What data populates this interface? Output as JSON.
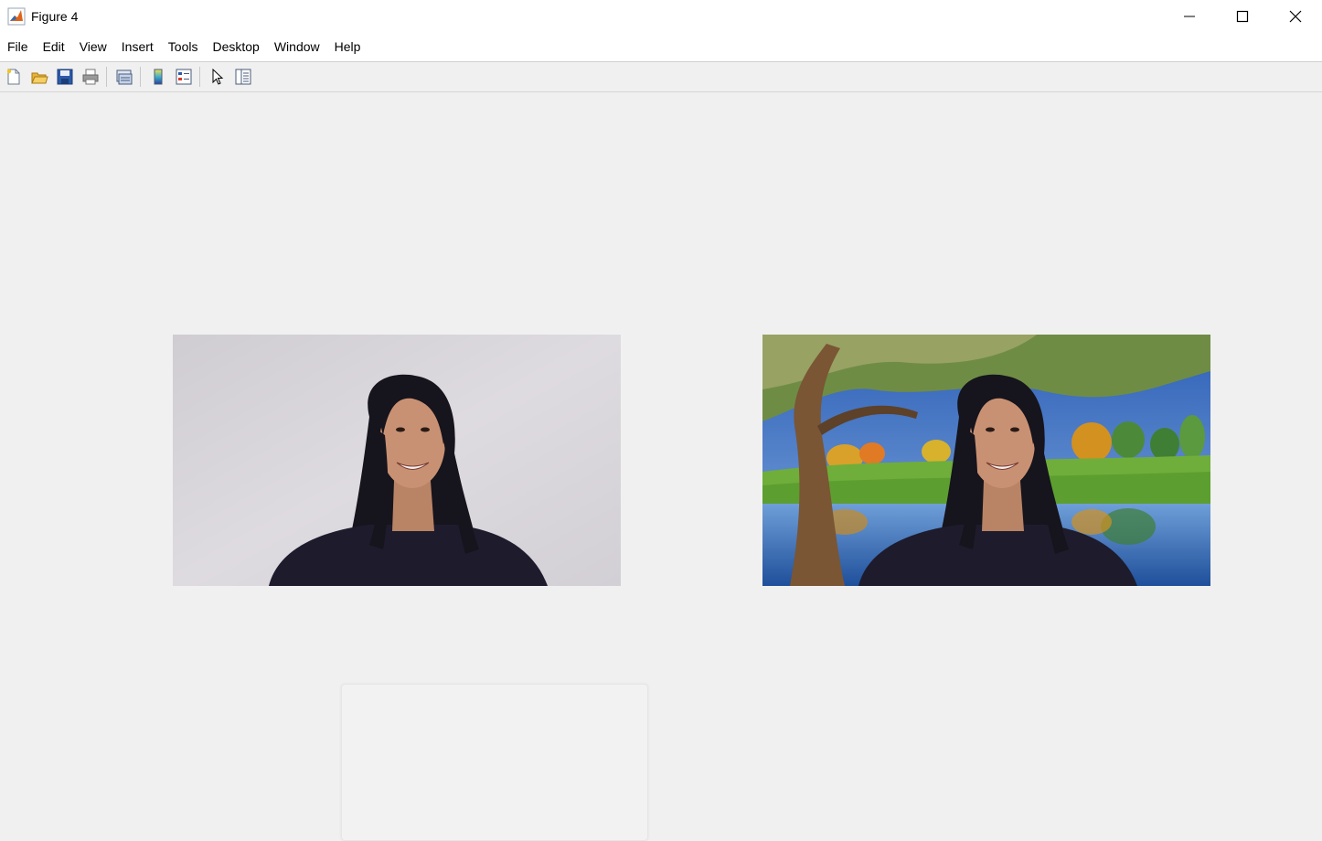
{
  "window": {
    "title": "Figure 4",
    "app_icon": "matlab-icon",
    "controls": [
      "minimize-icon",
      "maximize-icon",
      "close-icon"
    ]
  },
  "menu": {
    "items": [
      "File",
      "Edit",
      "View",
      "Insert",
      "Tools",
      "Desktop",
      "Window",
      "Help"
    ]
  },
  "toolbar": {
    "buttons": [
      "new-figure-icon",
      "open-file-icon",
      "save-icon",
      "print-icon",
      "link-plot-icon",
      "insert-colorbar-icon",
      "insert-legend-icon",
      "edit-plot-icon",
      "property-inspector-icon"
    ]
  },
  "figures": [
    {
      "name": "original-image",
      "description": "person on gray background"
    },
    {
      "name": "composited-image",
      "description": "person composited onto autumn park background"
    }
  ],
  "colors": {
    "window_bg": "#f0f0f0",
    "wall_gray": "#d6d3d8",
    "shirt": "#1c1a2a",
    "sky": "#3a6bc0",
    "grass": "#6fae3a",
    "water": "#2f6fb8"
  }
}
